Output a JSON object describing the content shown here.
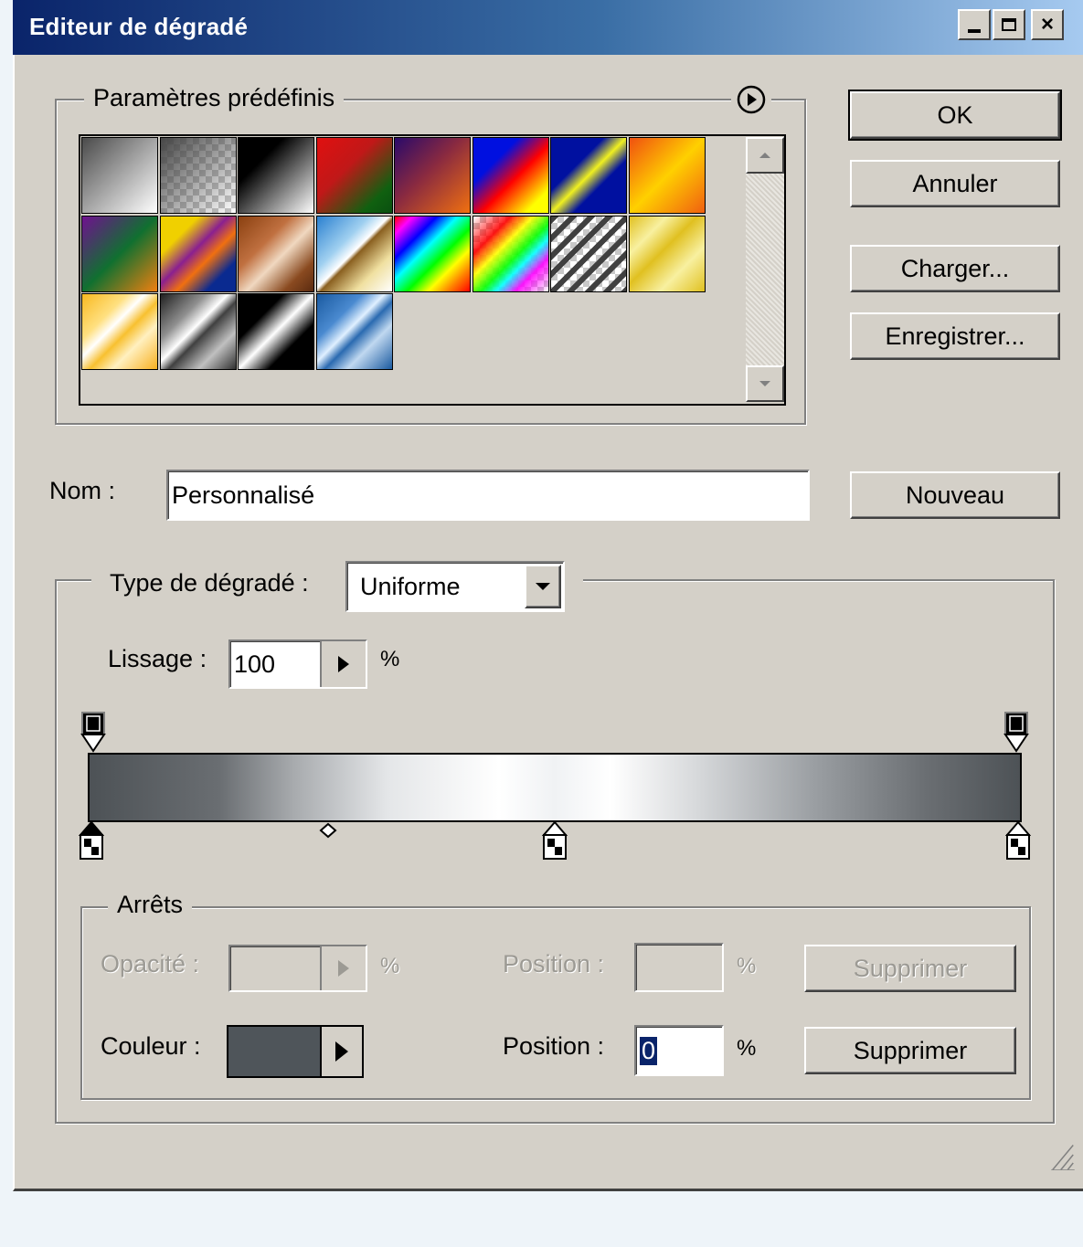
{
  "window": {
    "title": "Editeur de dégradé",
    "controls": [
      "minimize",
      "maximize",
      "close"
    ],
    "close_glyph": "×"
  },
  "presets": {
    "legend": "Paramètres prédéfinis",
    "menu_icon": "circle-arrow-icon",
    "swatches": [
      {
        "name": "foreground-to-background",
        "css": "linear-gradient(135deg,#4a4a4a 0%,#ffffff 100%)"
      },
      {
        "name": "foreground-to-transparent",
        "css": "linear-gradient(135deg,rgba(70,70,70,1) 0%,rgba(70,70,70,0) 100%)",
        "checker": true
      },
      {
        "name": "black-white",
        "css": "linear-gradient(135deg,#000 0%,#000 30%,#fff 100%)"
      },
      {
        "name": "red-green",
        "css": "linear-gradient(135deg,#e01010 0%,#c01818 40%,#106010 80%,#0a5010 100%)"
      },
      {
        "name": "violet-orange",
        "css": "linear-gradient(135deg,#2a0a6a 0%,#8a2a40 45%,#f07010 100%)"
      },
      {
        "name": "blue-red-yellow",
        "css": "linear-gradient(135deg,#0010e0 0%,#0010e0 30%,#ff0000 55%,#ffff00 85%,#ffff00 100%)"
      },
      {
        "name": "blue-yellow-blue",
        "css": "linear-gradient(135deg,#0010a0 0%,#0010a0 35%,#f0f020 50%,#0010a0 65%,#0010a0 100%)"
      },
      {
        "name": "orange-yellow-orange",
        "css": "linear-gradient(135deg,#f05010 0%,#ffd000 50%,#f06010 100%)"
      },
      {
        "name": "violet-green-orange",
        "css": "linear-gradient(135deg,#701090 0%,#107030 50%,#f08010 100%)"
      },
      {
        "name": "yellow-violet-orange-blue",
        "css": "linear-gradient(135deg,#f0d000 0%,#f0d000 25%,#8a2090 45%,#f07010 60%,#0a2a90 80%,#0a2a90 100%)"
      },
      {
        "name": "copper",
        "css": "linear-gradient(135deg,#8a4010 0%,#c07040 35%,#f0d8c0 55%,#8a4a20 80%,#5a2a10 100%)"
      },
      {
        "name": "chrome",
        "css": "linear-gradient(135deg,#2a80d0 0%,#a0d0f0 35%,#ffffff 48%,#8a6020 52%,#f0e0a0 75%,#ffffff 100%)"
      },
      {
        "name": "spectrum",
        "css": "linear-gradient(135deg,#ff0000 0%,#ff00ff 12%,#0000ff 28%,#00ffff 42%,#00ff00 58%,#ffff00 72%,#ff8000 85%,#ff0000 100%)"
      },
      {
        "name": "transparent-rainbow",
        "css": "linear-gradient(135deg,rgba(255,0,0,0) 0%,rgba(255,0,0,0.9) 25%,rgba(255,255,0,0.9) 40%,rgba(0,255,0,0.9) 55%,rgba(0,255,255,0.9) 65%,rgba(255,0,255,0.9) 78%,rgba(255,0,255,0) 100%)",
        "checker": true
      },
      {
        "name": "transparent-stripes",
        "css": "repeating-linear-gradient(135deg,#404040 0 6px,rgba(0,0,0,0) 6px 14px)",
        "checker": true
      },
      {
        "name": "gold-stripes",
        "css": "linear-gradient(135deg,#e0c020 0%,#f8f0a0 25%,#e0c020 45%,#f8f0a0 70%,#e0c020 100%)"
      },
      {
        "name": "gold-shine",
        "css": "linear-gradient(135deg,#f8b820 0%,#ffe080 30%,#ffffff 42%,#f8c030 55%,#fff0c0 70%,#f8b020 100%)"
      },
      {
        "name": "steel-stripes",
        "css": "linear-gradient(135deg,#202020 0%,#909090 30%,#ffffff 45%,#404040 55%,#c0c0c0 75%,#303030 100%)"
      },
      {
        "name": "black-chrome",
        "css": "linear-gradient(135deg,#000 0%,#000 30%,#ffffff 50%,#000 70%,#000 100%)"
      },
      {
        "name": "blue-chrome",
        "css": "linear-gradient(135deg,#1a5aa0 0%,#4a8ad0 30%,#e0f0ff 45%,#2a6ab0 55%,#c0d8f0 70%,#1a5aa0 100%)"
      }
    ]
  },
  "nom": {
    "label": "Nom :",
    "value": "Personnalisé"
  },
  "buttons": {
    "ok": "OK",
    "annuler": "Annuler",
    "charger": "Charger...",
    "enregistrer": "Enregistrer...",
    "nouveau": "Nouveau"
  },
  "gradient_type": {
    "label": "Type de dégradé :",
    "selected": "Uniforme"
  },
  "lissage": {
    "label": "Lissage :",
    "value": "100",
    "unit": "%"
  },
  "gradient": {
    "css": "linear-gradient(90deg,#4d5256 0%,#6a6e72 14%,#a8abae 22%,#e4e6e8 32%,#ffffff 44%,#f0f2f4 50%,#ffffff 56%,#d8dadc 65%,#9a9ea2 78%,#6a6e72 90%,#4d5256 100%)",
    "opacity_stops_pct": [
      0,
      100
    ],
    "color_stops_pct": [
      0,
      50,
      100
    ],
    "midpoint_pct": 25.5
  },
  "arrets": {
    "legend": "Arrêts",
    "opacite_label": "Opacité :",
    "opacite_unit": "%",
    "position_label_1": "Position :",
    "position_unit_1": "%",
    "supprimer_1": "Supprimer",
    "couleur_label": "Couleur :",
    "couleur_value": "#4f555a",
    "position_label_2": "Position :",
    "position_value_2": "0",
    "position_unit_2": "%",
    "supprimer_2": "Supprimer"
  }
}
